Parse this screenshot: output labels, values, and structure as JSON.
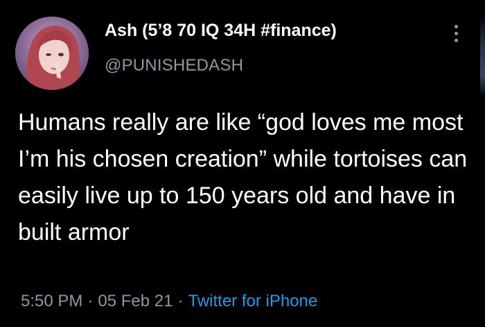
{
  "tweet": {
    "display_name": "Ash (5’8 70 IQ 34H #finance)",
    "handle": "@PUNISHEDASH",
    "text": "Humans really are like “god loves me most I’m his chosen creation” while tortoises can easily live up to 150 years old and have in built armor",
    "time": "5:50 PM",
    "date": "05 Feb 21",
    "separator": "·",
    "source": "Twitter for iPhone"
  },
  "colors": {
    "background": "#000000",
    "text": "#ffffff",
    "secondary": "#8b98a5",
    "link": "#1d9bf0"
  },
  "icons": {
    "more": "more-vertical-icon"
  }
}
